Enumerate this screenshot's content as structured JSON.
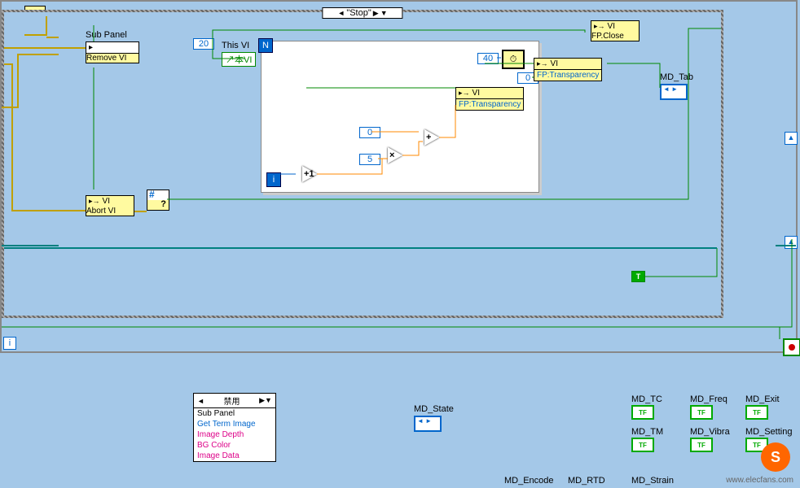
{
  "outer_loop": {
    "i_label": "i"
  },
  "case": {
    "selector": "\"Stop\""
  },
  "sub_panel": {
    "label": "Sub Panel",
    "method": "Remove VI"
  },
  "abort_vi": {
    "hdr": "VI",
    "method": "Abort VI"
  },
  "fp_close": {
    "hdr": "VI",
    "method": "FP.Close"
  },
  "fp_trans1": {
    "hdr": "VI",
    "prop": "FP:Transparency"
  },
  "fp_trans2": {
    "hdr": "VI",
    "prop": "FP:Transparency"
  },
  "for_loop": {
    "n_const": "20",
    "n_label": "N",
    "i_label": "i",
    "timer_const": "40"
  },
  "this_vi": {
    "label": "This VI",
    "text": "本VI"
  },
  "consts": {
    "zero": "0",
    "five": "5",
    "zero2": "0"
  },
  "ops": {
    "inc": "+1",
    "mul": "×",
    "add": "+"
  },
  "bool_true": "T",
  "md_tab": {
    "label": "MD_Tab"
  },
  "md_state": {
    "label": "MD_State"
  },
  "disabled_struct": {
    "selector": "禁用",
    "title": "Sub Panel",
    "rows": [
      "Get Term Image",
      "Image Depth",
      "BG Color",
      "Image Data"
    ]
  },
  "indicators": {
    "md_tc": "MD_TC",
    "md_freq": "MD_Freq",
    "md_exit": "MD_Exit",
    "md_tm": "MD_TM",
    "md_vibra": "MD_Vibra",
    "md_setting": "MD_Setting",
    "md_encode": "MD_Encode",
    "md_rtd": "MD_RTD",
    "md_strain": "MD_Strain"
  },
  "watermark": "www.elecfans.com"
}
